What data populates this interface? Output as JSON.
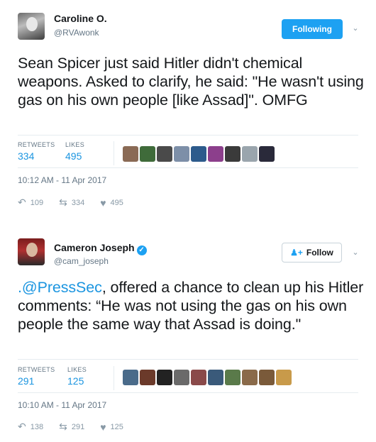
{
  "tweets": [
    {
      "name": "Caroline O.",
      "handle": "@RVAwonk",
      "follow_label": "Following",
      "text": "Sean Spicer just said Hitler didn't chemical weapons. Asked to clarify, he said: \"He wasn't using gas on his own people [like Assad]\". OMFG",
      "retweets_label": "RETWEETS",
      "retweets": "334",
      "likes_label": "LIKES",
      "likes": "495",
      "timestamp": "10:12 AM - 11 Apr 2017",
      "reply_count": "109",
      "retweet_count": "334",
      "like_count": "495",
      "liker_colors": [
        "#8a6a55",
        "#3f6b3a",
        "#4a4a4a",
        "#7d8fa8",
        "#2d5b8c",
        "#8c3f8c",
        "#3a3a3a",
        "#9aa5ad",
        "#2a2a3a"
      ]
    },
    {
      "name": "Cameron Joseph",
      "handle": "@cam_joseph",
      "follow_label": "Follow",
      "mention": ".@PressSec",
      "text_rest": ", offered a chance to clean up his Hitler comments: “He was not using the gas on his own people the same way that Assad is doing.\"",
      "retweets_label": "RETWEETS",
      "retweets": "291",
      "likes_label": "LIKES",
      "likes": "125",
      "timestamp": "10:10 AM - 11 Apr 2017",
      "reply_count": "138",
      "retweet_count": "291",
      "like_count": "125",
      "liker_colors": [
        "#4a6b8a",
        "#6b3a2a",
        "#222222",
        "#6a6a6a",
        "#8a4a4a",
        "#3a5a7a",
        "#5a7a4a",
        "#8a6a4a",
        "#7a5a3a",
        "#c89a4a"
      ]
    }
  ],
  "icons": {
    "reply": "reply-icon",
    "retweet": "retweet-icon",
    "like": "heart-icon",
    "verified": "verified-badge-icon",
    "chevron": "chevron-down-icon",
    "follow_plus": "add-person-icon"
  }
}
